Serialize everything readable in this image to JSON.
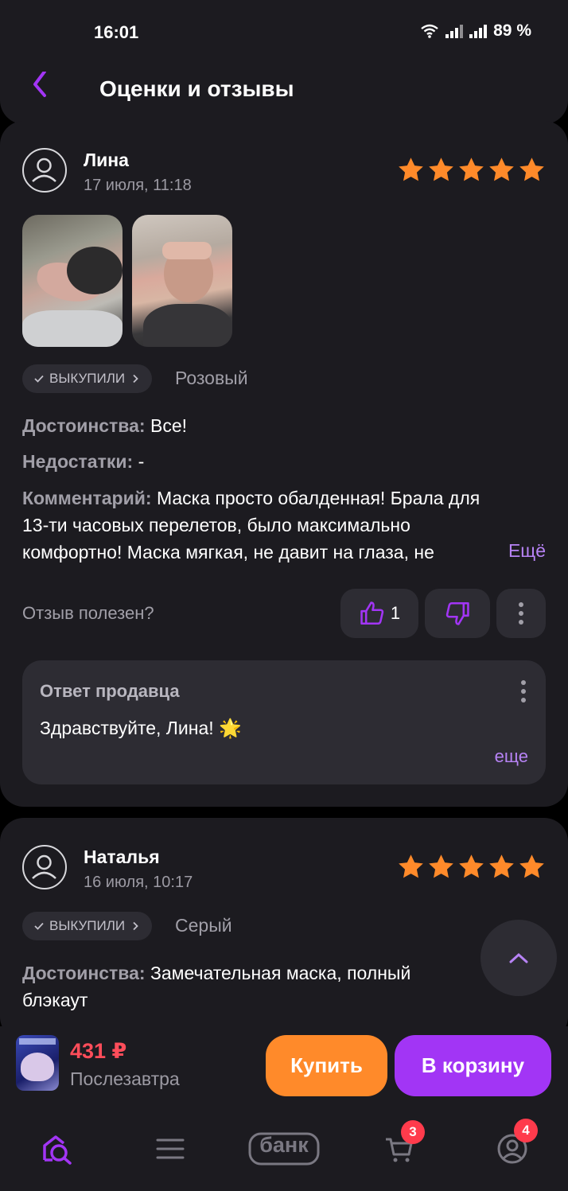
{
  "status_bar": {
    "time": "16:01",
    "battery": "89 %"
  },
  "header": {
    "title": "Оценки и отзывы"
  },
  "reviews": [
    {
      "author": "Лина",
      "date": "17 июля, 11:18",
      "rating": 5,
      "tag": "ВЫКУПИЛИ",
      "color": "Розовый",
      "pros_label": "Достоинства:",
      "pros": "Все!",
      "cons_label": "Недостатки:",
      "cons": "-",
      "comment_label": "Комментарий:",
      "comment_line1": "Маска просто обалденная! Брала для",
      "comment_line2": "13-ти часовых перелетов, было максимально",
      "comment_line3": "комфортно! Маска мягкая, не давит на глаза, не",
      "more": "Ещё",
      "useful_question": "Отзыв полезен?",
      "likes": "1",
      "seller_reply": {
        "title": "Ответ продавца",
        "text": "Здравствуйте, Лина! 🌟",
        "more": "еще"
      }
    },
    {
      "author": "Наталья",
      "date": "16 июля, 10:17",
      "rating": 5,
      "tag": "ВЫКУПИЛИ",
      "color": "Серый",
      "pros_label": "Достоинства:",
      "pros_line1": "Замечательная маска, полный",
      "pros_line2": "блэкаут"
    }
  ],
  "buy_bar": {
    "price": "431 ₽",
    "delivery": "Послезавтра",
    "buy_label": "Купить",
    "cart_label": "В корзину"
  },
  "bottom_nav": {
    "bank_label": "банк",
    "cart_badge": "3",
    "profile_badge": "4"
  },
  "colors": {
    "accent": "#a235f5",
    "buy": "#ff8a2a",
    "star": "#ff8a2a",
    "price": "#ff4d5a",
    "link": "#b783f5"
  }
}
